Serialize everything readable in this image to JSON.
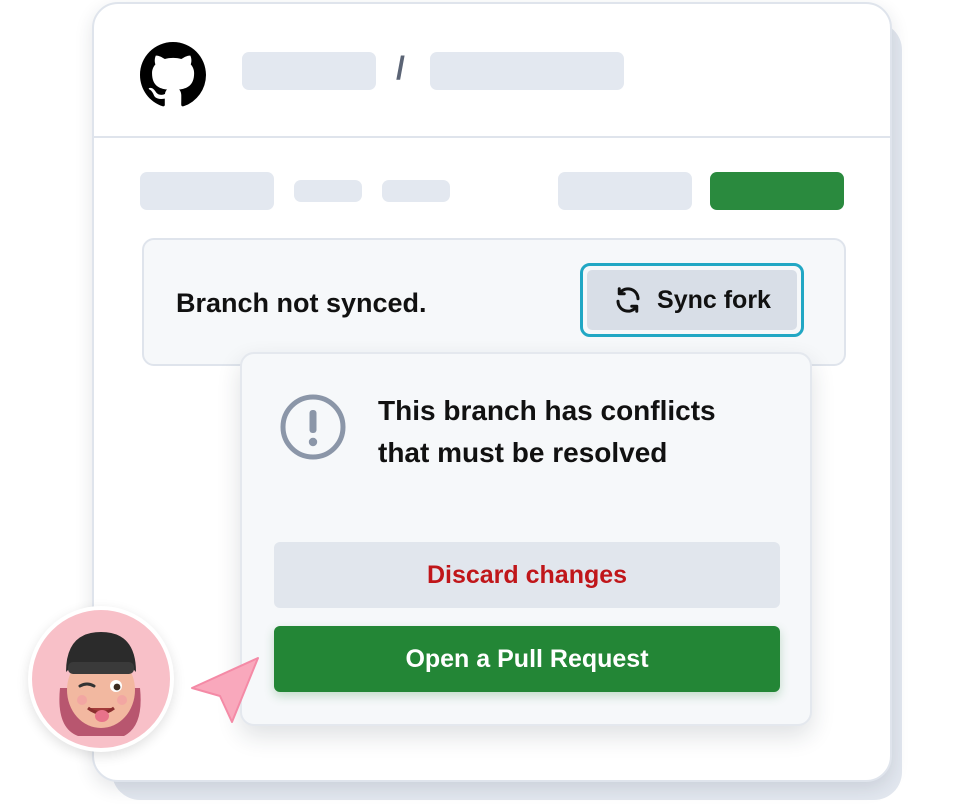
{
  "header": {
    "separator": "/"
  },
  "sync_bar": {
    "status_text": "Branch not synced.",
    "sync_button_label": "Sync fork"
  },
  "conflict_popup": {
    "message": "This branch has conflicts that must be resolved",
    "discard_label": "Discard changes",
    "pull_request_label": "Open a Pull Request"
  },
  "icons": {
    "logo": "github-icon",
    "sync": "sync-icon",
    "warning": "alert-circle-icon",
    "cursor": "pointer-arrow-icon"
  },
  "colors": {
    "accent_green": "#238636",
    "focus_ring": "#21a7c4",
    "danger_text": "#c0161a",
    "placeholder": "#e3e8f0",
    "cursor_pink": "#f9a8bc"
  }
}
